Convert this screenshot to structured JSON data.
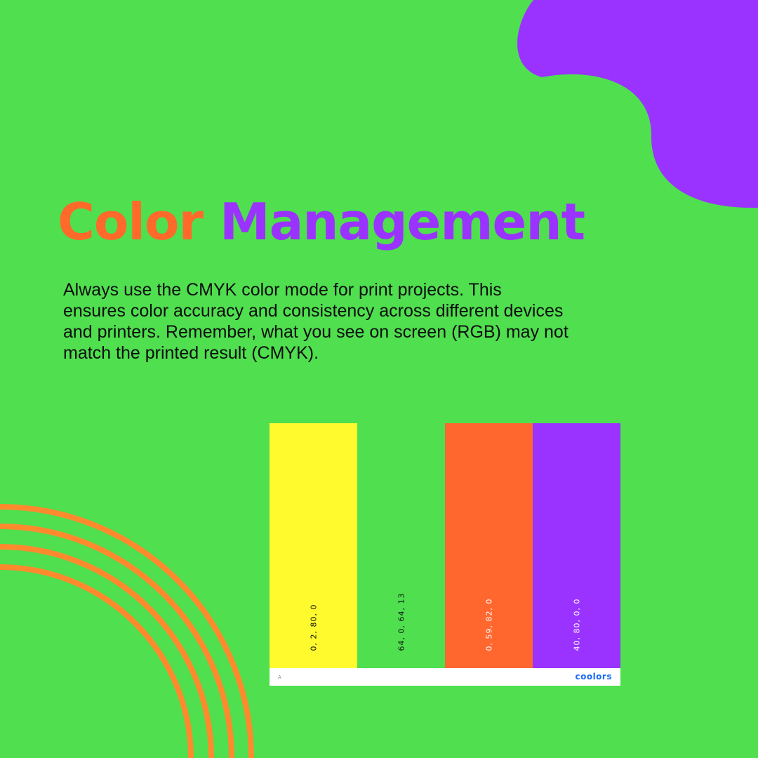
{
  "colors": {
    "background": "#4fdf4f",
    "orange": "#ff6a2b",
    "purple": "#9a33ff",
    "arc": "#ff8a2e"
  },
  "title": {
    "word1": "Color",
    "word2": "Management"
  },
  "body_text": "Always use the CMYK color mode for print projects. This ensures color accuracy and consistency across different devices and printers. Remember, what you see on screen (RGB) may not match the printed result (CMYK).",
  "palette": {
    "swatches": [
      {
        "color": "#fffa2d",
        "label": "0, 2, 80, 0",
        "text_color": "#111111"
      },
      {
        "color": "#4fdf4f",
        "label": "64, 0, 64, 13",
        "text_color": "#111111"
      },
      {
        "color": "#ff672e",
        "label": "0, 59, 82, 0",
        "text_color": "#ffffff"
      },
      {
        "color": "#9a33ff",
        "label": "40, 80, 0, 0",
        "text_color": "#ffffff"
      }
    ],
    "footer_letter": "A",
    "logo": "coolors"
  }
}
